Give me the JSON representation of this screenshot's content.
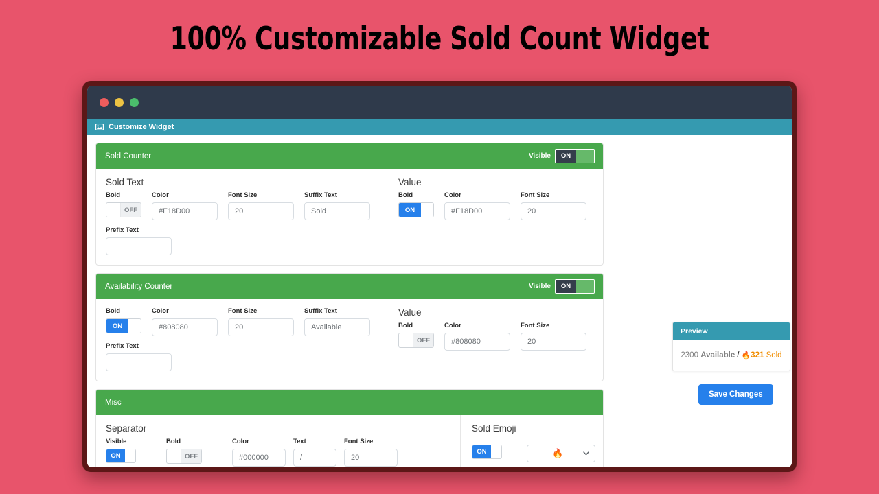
{
  "banner": {
    "title": "100% Customizable Sold Count Widget"
  },
  "window": {
    "titlebar": {
      "dots": [
        "close-red",
        "minimize-yellow",
        "maximize-green"
      ]
    },
    "appbar": {
      "icon": "picture-icon",
      "label": "Customize Widget"
    }
  },
  "sections": {
    "sold_counter": {
      "title": "Sold Counter",
      "visible_label": "Visible",
      "visible_toggle": "ON",
      "text_group": {
        "heading": "Sold Text",
        "bold_label": "Bold",
        "bold_toggle": "OFF",
        "color_label": "Color",
        "color_value": "#F18D00",
        "font_size_label": "Font Size",
        "font_size_value": "20",
        "suffix_label": "Suffix Text",
        "suffix_value": "Sold",
        "prefix_label": "Prefix Text",
        "prefix_value": ""
      },
      "value_group": {
        "heading": "Value",
        "bold_label": "Bold",
        "bold_toggle": "ON",
        "color_label": "Color",
        "color_value": "#F18D00",
        "font_size_label": "Font Size",
        "font_size_value": "20"
      }
    },
    "availability_counter": {
      "title": "Availability Counter",
      "visible_label": "Visible",
      "visible_toggle": "ON",
      "text_group": {
        "bold_label": "Bold",
        "bold_toggle": "ON",
        "color_label": "Color",
        "color_value": "#808080",
        "font_size_label": "Font Size",
        "font_size_value": "20",
        "suffix_label": "Suffix Text",
        "suffix_value": "Available",
        "prefix_label": "Prefix Text",
        "prefix_value": ""
      },
      "value_group": {
        "heading": "Value",
        "bold_label": "Bold",
        "bold_toggle": "OFF",
        "color_label": "Color",
        "color_value": "#808080",
        "font_size_label": "Font Size",
        "font_size_value": "20"
      }
    },
    "misc": {
      "title": "Misc",
      "separator": {
        "heading": "Separator",
        "visible_label": "Visible",
        "visible_toggle": "ON",
        "bold_label": "Bold",
        "bold_toggle": "OFF",
        "color_label": "Color",
        "color_value": "#000000",
        "text_label": "Text",
        "text_value": "/",
        "font_size_label": "Font Size",
        "font_size_value": "20"
      },
      "sold_emoji": {
        "heading": "Sold Emoji",
        "toggle": "ON",
        "selected_emoji": "🔥",
        "chevron": "chevron-down-icon"
      }
    }
  },
  "preview": {
    "heading": "Preview",
    "available_number": "2300",
    "available_text": "Available",
    "separator": "/",
    "sold_emoji": "🔥",
    "sold_number": "321",
    "sold_text": "Sold"
  },
  "actions": {
    "save_label": "Save Changes"
  },
  "colors": {
    "page_background": "#e8546b",
    "window_border": "#5c1717",
    "titlebar": "#2f3a4b",
    "appbar": "#359ab0",
    "section_header": "#48a84c",
    "toggle_on": "#2680eb",
    "primary_button": "#2680eb",
    "sold_accent": "#F18D00",
    "available_accent": "#808080"
  }
}
